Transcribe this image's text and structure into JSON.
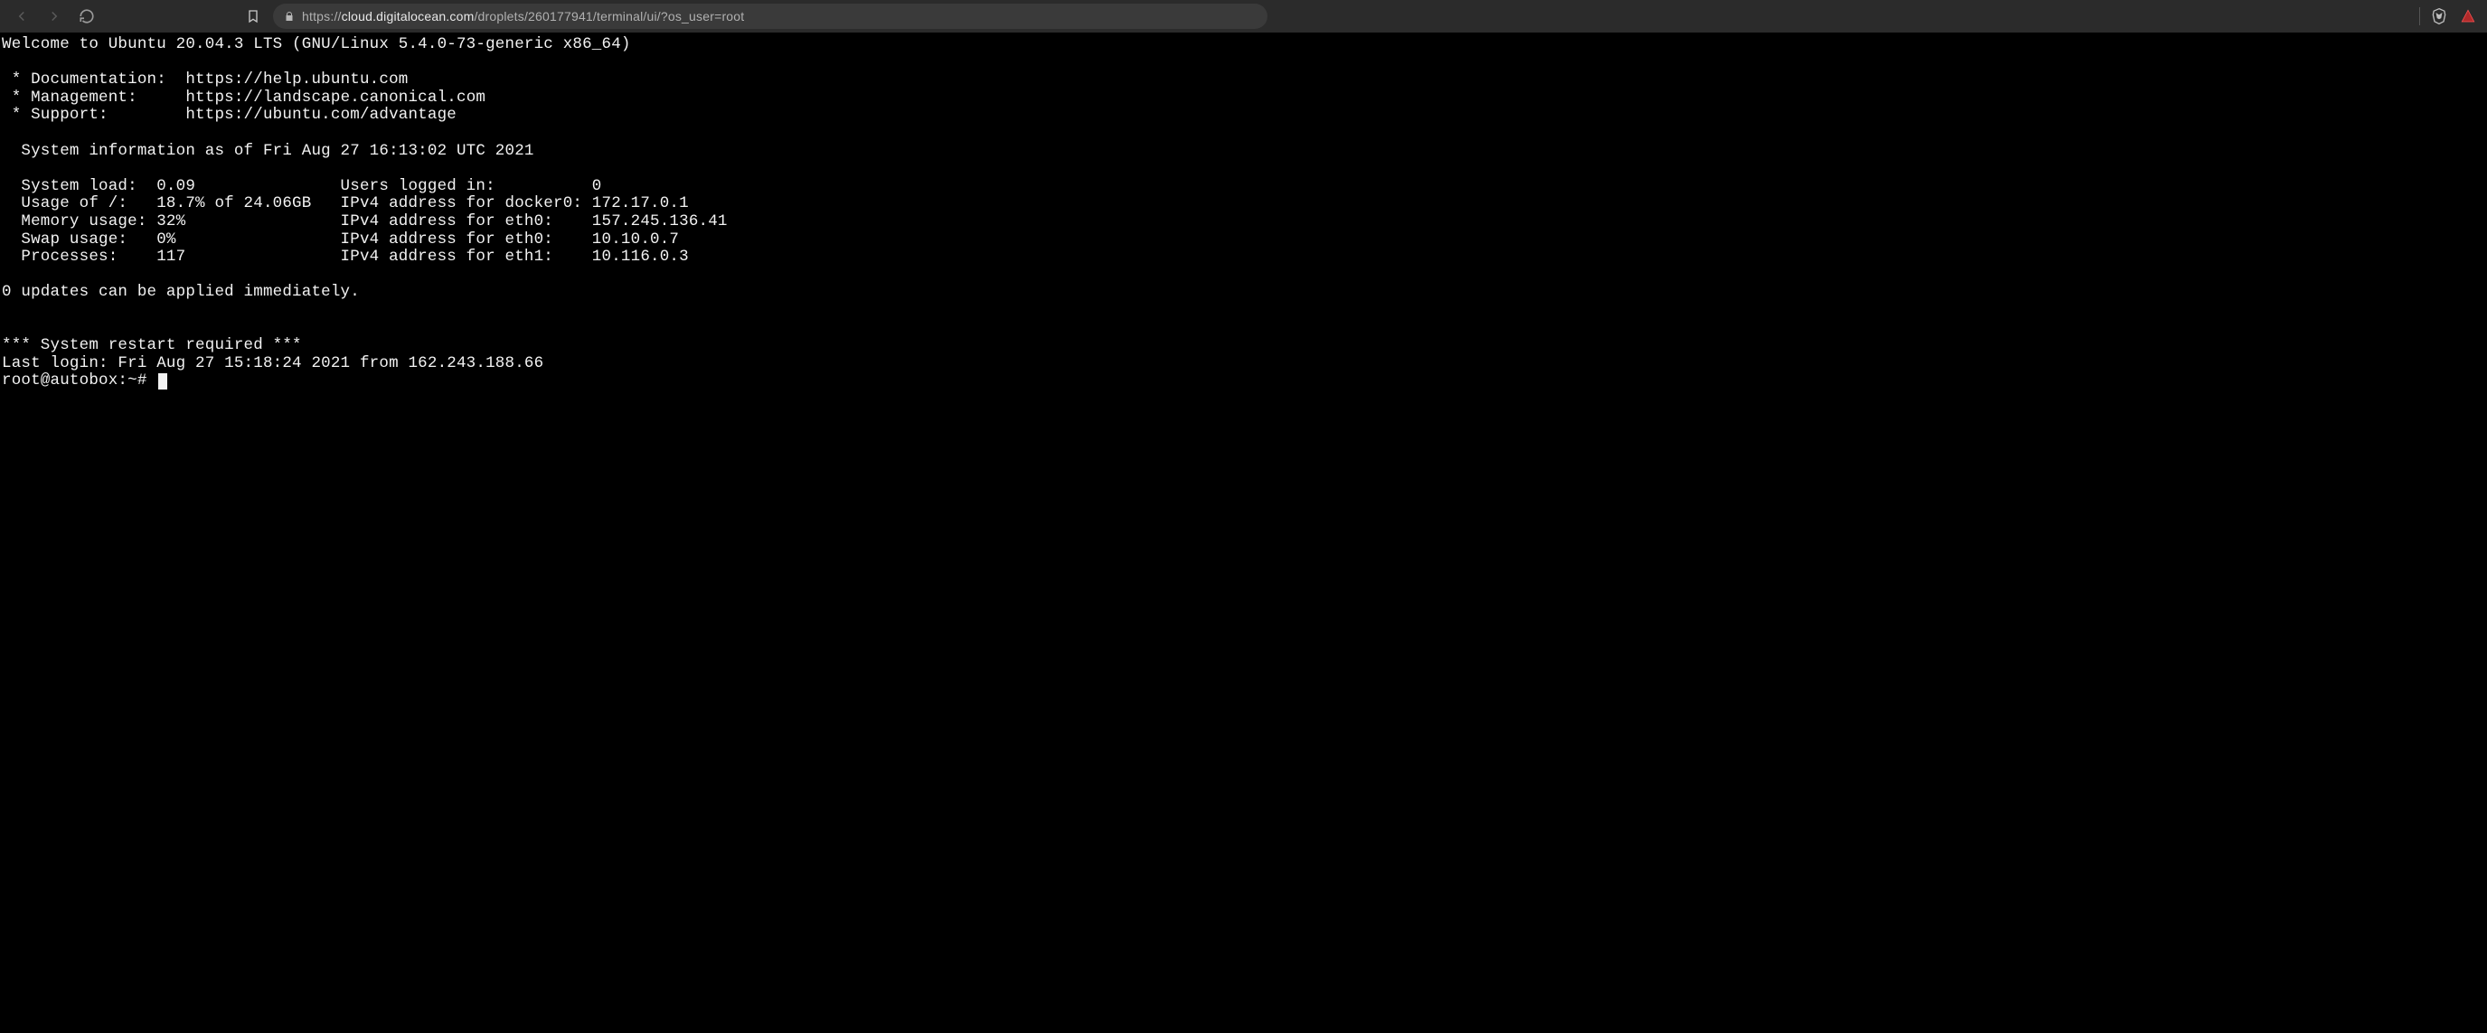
{
  "browser": {
    "url_prefix": "https://",
    "url_domain": "cloud.digitalocean.com",
    "url_path": "/droplets/260177941/terminal/ui/?os_user=root"
  },
  "terminal": {
    "welcome": "Welcome to Ubuntu 20.04.3 LTS (GNU/Linux 5.4.0-73-generic x86_64)",
    "links": {
      "doc_label": " * Documentation:  ",
      "doc_url": "https://help.ubuntu.com",
      "mgmt_label": " * Management:     ",
      "mgmt_url": "https://landscape.canonical.com",
      "support_label": " * Support:        ",
      "support_url": "https://ubuntu.com/advantage"
    },
    "sysinfo_header": "  System information as of Fri Aug 27 16:13:02 UTC 2021",
    "stats": {
      "row1": "  System load:  0.09               Users logged in:          0",
      "row2": "  Usage of /:   18.7% of 24.06GB   IPv4 address for docker0: 172.17.0.1",
      "row3": "  Memory usage: 32%                IPv4 address for eth0:    157.245.136.41",
      "row4": "  Swap usage:   0%                 IPv4 address for eth0:    10.10.0.7",
      "row5": "  Processes:    117                IPv4 address for eth1:    10.116.0.3"
    },
    "updates": "0 updates can be applied immediately.",
    "restart_warning": "*** System restart required ***",
    "last_login": "Last login: Fri Aug 27 15:18:24 2021 from 162.243.188.66",
    "prompt": "root@autobox:~# "
  }
}
